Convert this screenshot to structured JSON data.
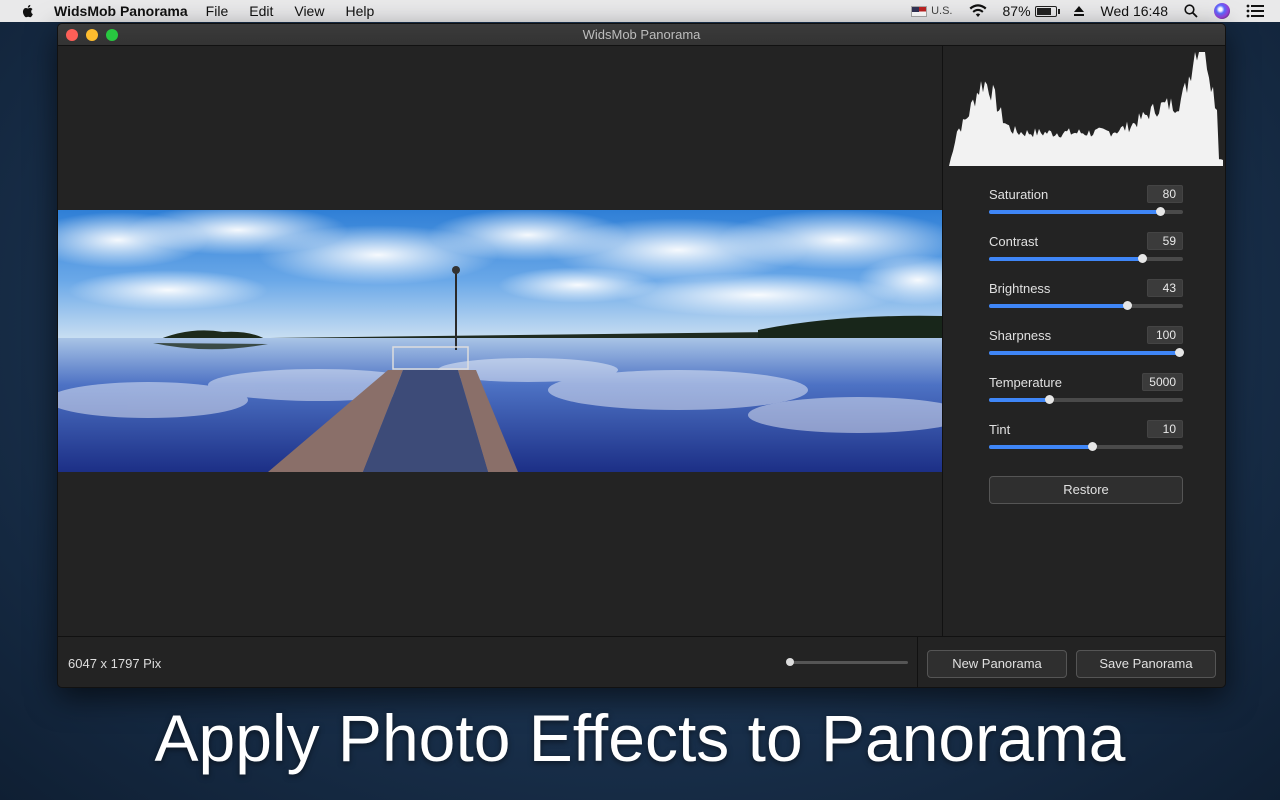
{
  "menubar": {
    "app_name": "WidsMob Panorama",
    "menus": [
      "File",
      "Edit",
      "View",
      "Help"
    ],
    "input_source": "U.S.",
    "battery_percent": "87%",
    "battery_level": 0.87,
    "clock": "Wed 16:48",
    "icons": [
      "apple-icon",
      "flag-icon",
      "wifi-icon",
      "battery-icon",
      "eject-icon",
      "search-icon",
      "siri-icon",
      "notification-center-icon"
    ]
  },
  "window": {
    "title": "WidsMob Panorama"
  },
  "adjustments": [
    {
      "label": "Saturation",
      "value": "80",
      "level": 0.88
    },
    {
      "label": "Contrast",
      "value": "59",
      "level": 0.79
    },
    {
      "label": "Brightness",
      "value": "43",
      "level": 0.71
    },
    {
      "label": "Sharpness",
      "value": "100",
      "level": 0.98
    },
    {
      "label": "Temperature",
      "value": "5000",
      "level": 0.31
    },
    {
      "label": "Tint",
      "value": "10",
      "level": 0.53
    }
  ],
  "restore_label": "Restore",
  "status": {
    "dimensions": "6047 x 1797 Pix",
    "zoom_level": 0.0
  },
  "buttons": {
    "new_panorama": "New Panorama",
    "save_panorama": "Save Panorama"
  },
  "caption": "Apply Photo Effects to Panorama",
  "colors": {
    "accent": "#3f86f7",
    "window_bg": "#232323",
    "close": "#fc5f57",
    "minimize": "#fdbc2e",
    "zoom": "#28c840"
  }
}
